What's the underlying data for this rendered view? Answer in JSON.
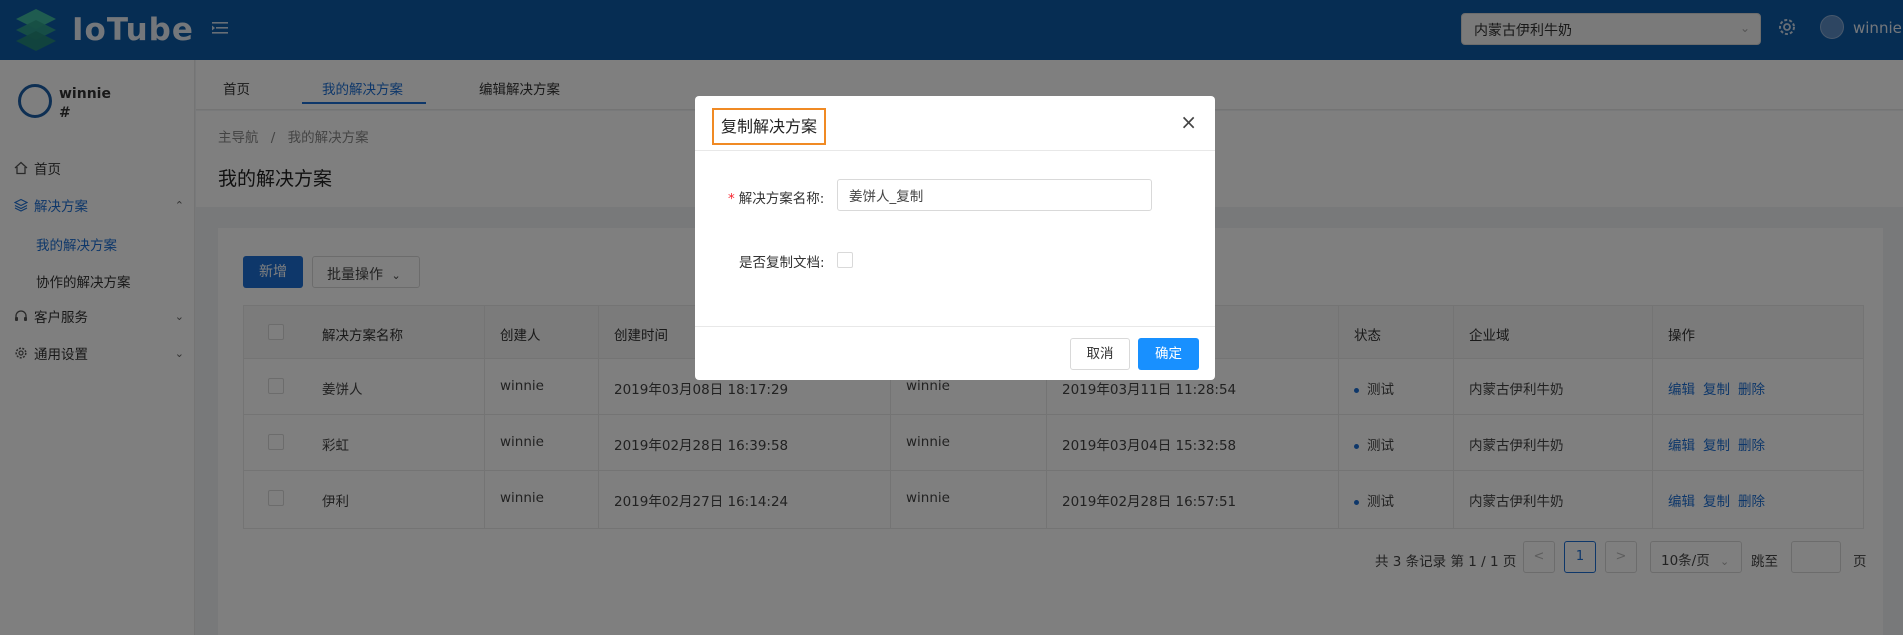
{
  "header": {
    "logo_text": "IoTube",
    "tenant": "内蒙古伊利牛奶",
    "user": "winnie"
  },
  "sidebar": {
    "user_name": "winnie",
    "user_sub": "#",
    "items": [
      {
        "label": "首页",
        "icon": "home-icon"
      },
      {
        "label": "解决方案",
        "icon": "layers-icon"
      },
      {
        "label": "我的解决方案"
      },
      {
        "label": "协作的解决方案"
      },
      {
        "label": "客户服务",
        "icon": "headset-icon"
      },
      {
        "label": "通用设置",
        "icon": "gear-icon"
      }
    ]
  },
  "tabs": [
    "首页",
    "我的解决方案",
    "编辑解决方案"
  ],
  "breadcrumb": {
    "root": "主导航",
    "sep": "/",
    "current": "我的解决方案"
  },
  "page_title": "我的解决方案",
  "toolbar": {
    "add": "新增",
    "batch": "批量操作"
  },
  "table": {
    "columns": [
      "解决方案名称",
      "创建人",
      "创建时间",
      "状态",
      "企业域",
      "操作"
    ],
    "rows": [
      {
        "name": "姜饼人",
        "creator": "winnie",
        "created": "2019年03月08日 18:17:29",
        "modifier": "winnie",
        "modified": "2019年03月11日 11:28:54",
        "status": "测试",
        "domain": "内蒙古伊利牛奶"
      },
      {
        "name": "彩虹",
        "creator": "winnie",
        "created": "2019年02月28日 16:39:58",
        "modifier": "winnie",
        "modified": "2019年03月04日 15:32:58",
        "status": "测试",
        "domain": "内蒙古伊利牛奶"
      },
      {
        "name": "伊利",
        "creator": "winnie",
        "created": "2019年02月27日 16:14:24",
        "modifier": "winnie",
        "modified": "2019年02月28日 16:57:51",
        "status": "测试",
        "domain": "内蒙古伊利牛奶"
      }
    ],
    "actions": [
      "编辑",
      "复制",
      "删除"
    ]
  },
  "pagination": {
    "summary": "共 3 条记录 第 1 / 1 页",
    "prev": "<",
    "page": "1",
    "next": ">",
    "page_size": "10条/页",
    "jump": "跳至",
    "page_unit": "页"
  },
  "modal": {
    "title": "复制解决方案",
    "close": "×",
    "name_label": "解决方案名称:",
    "name_value": "姜饼人_复制",
    "copy_docs_label": "是否复制文档:",
    "cancel": "取消",
    "ok": "确定"
  }
}
